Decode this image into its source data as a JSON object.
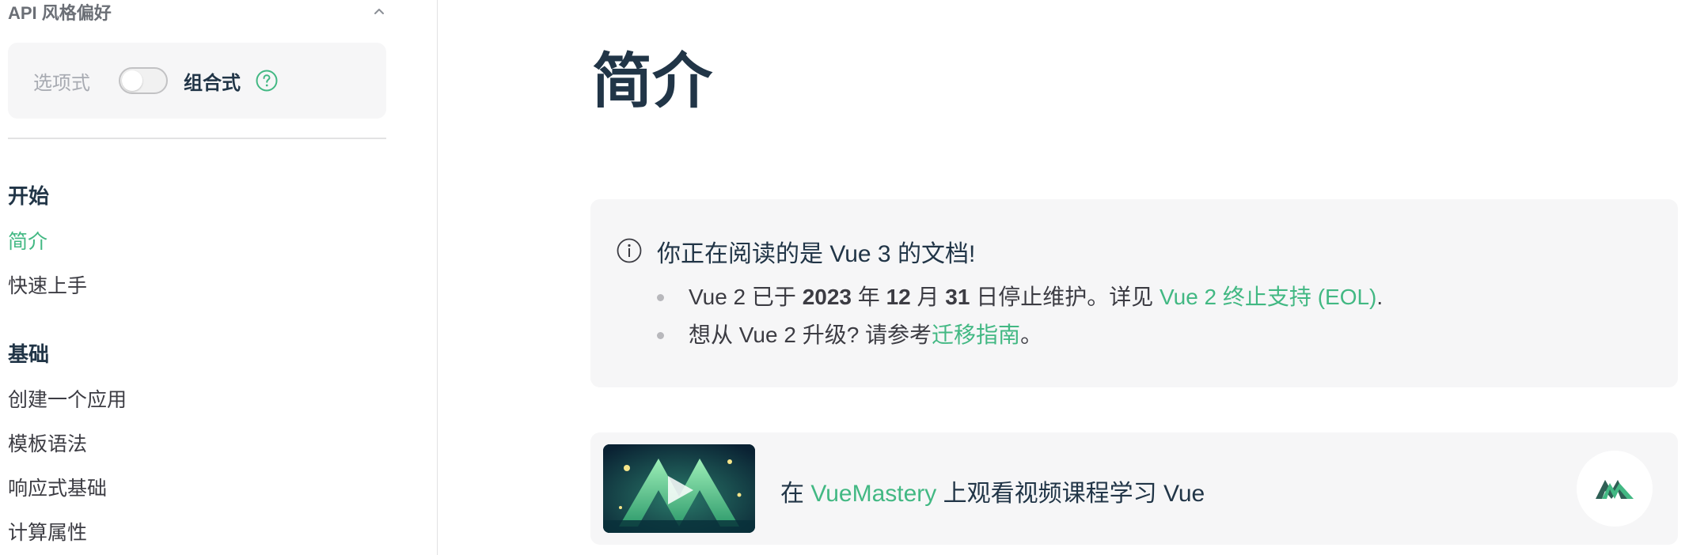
{
  "sidebar": {
    "api_pref_title": "API 风格偏好",
    "options_label": "选项式",
    "composition_label": "组合式",
    "groups": [
      {
        "title": "开始",
        "items": [
          {
            "label": "简介",
            "active": true
          },
          {
            "label": "快速上手",
            "active": false
          }
        ]
      },
      {
        "title": "基础",
        "items": [
          {
            "label": "创建一个应用",
            "active": false
          },
          {
            "label": "模板语法",
            "active": false
          },
          {
            "label": "响应式基础",
            "active": false
          },
          {
            "label": "计算属性",
            "active": false
          }
        ]
      }
    ]
  },
  "main": {
    "title": "简介",
    "notice": {
      "title": "你正在阅读的是 Vue 3 的文档!",
      "line1": {
        "prefix": "Vue 2 已于 ",
        "year": "2023",
        "t1": " 年 ",
        "month": "12",
        "t2": " 月 ",
        "day": "31",
        "t3": " 日停止维护。详见 ",
        "link": "Vue 2 终止支持 (EOL)",
        "suffix": "."
      },
      "line2": {
        "prefix": "想从 Vue 2 升级? 请参考",
        "link": "迁移指南",
        "suffix": "。"
      }
    },
    "vuemastery": {
      "prefix": "在 ",
      "link": "VueMastery",
      "suffix": " 上观看视频课程学习 Vue"
    }
  },
  "colors": {
    "accent": "#42b883",
    "text": "#213547",
    "muted": "#3c3c43",
    "panel": "#f6f6f7"
  },
  "icons": {
    "chevron": "chevron-up-icon",
    "help": "question-circle-icon",
    "info": "info-circle-icon",
    "logo": "vuemastery-logo-icon",
    "thumb": "play-video-icon"
  }
}
